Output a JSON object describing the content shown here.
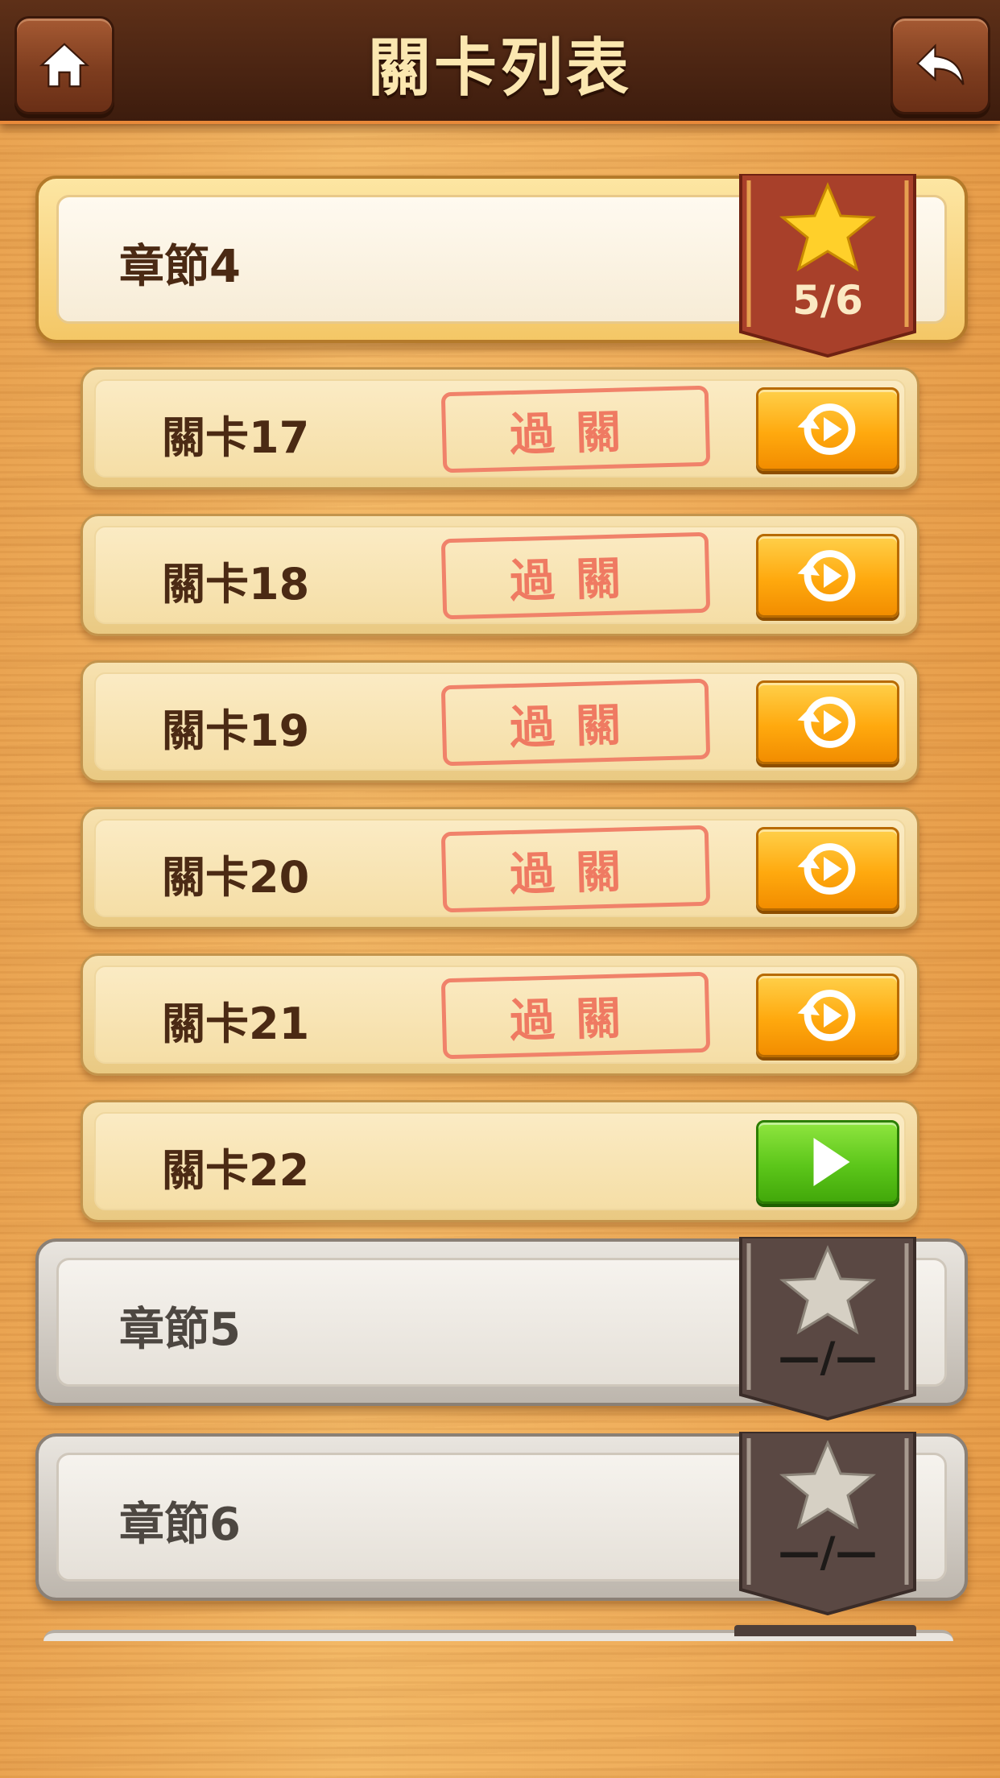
{
  "header": {
    "title": "關卡列表",
    "home_icon": "home-icon",
    "back_icon": "back-arrow-icon"
  },
  "chapters": [
    {
      "label": "章節4",
      "stars": "5/6",
      "state": "active"
    },
    {
      "label": "章節5",
      "stars": "—/—",
      "state": "locked"
    },
    {
      "label": "章節6",
      "stars": "—/—",
      "state": "locked"
    }
  ],
  "levels": [
    {
      "label": "關卡17",
      "stamp": "過關",
      "action": "replay"
    },
    {
      "label": "關卡18",
      "stamp": "過關",
      "action": "replay"
    },
    {
      "label": "關卡19",
      "stamp": "過關",
      "action": "replay"
    },
    {
      "label": "關卡20",
      "stamp": "過關",
      "action": "replay"
    },
    {
      "label": "關卡21",
      "stamp": "過關",
      "action": "replay"
    },
    {
      "label": "關卡22",
      "stamp": "",
      "action": "play"
    }
  ],
  "colors": {
    "header_bg": "#4a2412",
    "title": "#fbe7b0",
    "stamp": "#ef7a62",
    "replay_button": "#ffa90e",
    "play_button": "#5cc61a"
  }
}
